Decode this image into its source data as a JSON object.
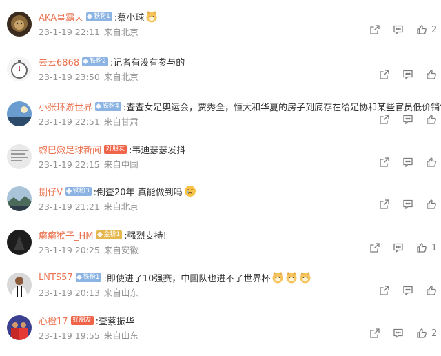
{
  "comments": [
    {
      "user": "AKA皇霸天",
      "badge": "铁粉1",
      "badge_type": "fan",
      "text": ":蔡小球",
      "emojis": 1,
      "date": "23-1-19 22:11",
      "loc": "来自北京",
      "likes": "2",
      "avatar_icon": "lion-icon"
    },
    {
      "user": "去云6868",
      "badge": "铁粉2",
      "badge_type": "fan",
      "text": ":记者有没有参与的",
      "emojis": 0,
      "date": "23-1-19 23:50",
      "loc": "来自北京",
      "likes": "",
      "avatar_icon": "stopwatch-icon"
    },
    {
      "user": "小张环游世界",
      "badge": "铁粉4",
      "badge_type": "fan",
      "text": ":查查女足奥运会，贾秀全，恒大和华夏的房子到底存在给足协和某些官员低价销售",
      "emojis": 0,
      "date": "23-1-19 22:51",
      "loc": "来自甘肃",
      "likes": "",
      "avatar_icon": "sky-icon"
    },
    {
      "user": "黎巴嫩足球新闻",
      "badge": "好朋友",
      "badge_type": "friend",
      "text": ":韦迪瑟瑟发抖",
      "emojis": 0,
      "date": "23-1-19 22:15",
      "loc": "来自中国",
      "likes": "",
      "avatar_icon": "document-icon"
    },
    {
      "user": "捌仔V",
      "badge": "铁粉3",
      "badge_type": "fan",
      "text": ":倒查20年 真能做到吗",
      "emojis": 1,
      "emoji_kind": "face",
      "date": "23-1-19 21:21",
      "loc": "来自北京",
      "likes": "",
      "avatar_icon": "landscape-icon"
    },
    {
      "user": "癞癞猴子_HM",
      "badge": "金粉1",
      "badge_type": "fan2",
      "text": ":强烈支持!",
      "emojis": 0,
      "date": "23-1-19 20:25",
      "loc": "来自安徽",
      "likes": "1",
      "avatar_icon": "dark-photo-icon"
    },
    {
      "user": "LNTS57",
      "badge": "铁粉1",
      "badge_type": "fan",
      "text": ":即使进了10强赛，中国队也进不了世界杯",
      "emojis": 3,
      "date": "23-1-19 20:13",
      "loc": "来自山东",
      "likes": "",
      "avatar_icon": "player-icon"
    },
    {
      "user": "心橙17",
      "badge": "好朋友",
      "badge_type": "friend",
      "text": ":查蔡振华",
      "emojis": 0,
      "date": "23-1-19 19:55",
      "loc": "来自山东",
      "likes": "2",
      "avatar_icon": "team-icon"
    }
  ]
}
